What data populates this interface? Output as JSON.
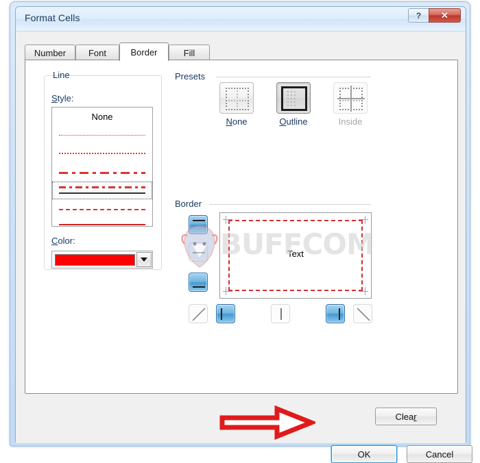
{
  "window": {
    "title": "Format Cells",
    "help_button": "?",
    "close_button": "✕",
    "help_icon": "question-mark-icon",
    "close_icon": "close-x-icon"
  },
  "tabs": [
    {
      "label": "Number",
      "active": false
    },
    {
      "label": "Font",
      "active": false
    },
    {
      "label": "Border",
      "active": true
    },
    {
      "label": "Fill",
      "active": false
    }
  ],
  "line_group": {
    "title": "Line",
    "style_label": "Style:",
    "style_none_option": "None",
    "color_label": "Color:",
    "selected_color": "#FF0000",
    "dropdown_icon": "chevron-down-icon",
    "styles": [
      {
        "id": "none",
        "name": "None",
        "selected": false
      },
      {
        "id": "fine-dotted",
        "name": "Fine dotted",
        "selected": false
      },
      {
        "id": "dotted",
        "name": "Dotted",
        "selected": false
      },
      {
        "id": "dash-dot-lg",
        "name": "Long dash dot",
        "selected": false
      },
      {
        "id": "dash-dot",
        "name": "Dash dot",
        "selected": true
      },
      {
        "id": "dashed",
        "name": "Dashed",
        "selected": false
      },
      {
        "id": "solid",
        "name": "Solid",
        "selected": false
      }
    ]
  },
  "presets": {
    "title": "Presets",
    "items": [
      {
        "label": "None",
        "accel": "N",
        "state": "normal",
        "icon": "border-none-icon"
      },
      {
        "label": "Outline",
        "accel": "O",
        "state": "pressed",
        "icon": "border-outline-icon"
      },
      {
        "label": "Inside",
        "accel": "I",
        "state": "disabled",
        "icon": "border-inside-icon"
      }
    ]
  },
  "border": {
    "title": "Border",
    "preview_text": "Text",
    "preview_border_color": "#D13030",
    "preview_border_style": "dash-dot",
    "edges_applied": [
      "top",
      "bottom",
      "left",
      "right"
    ],
    "side_buttons": [
      {
        "id": "top",
        "icon": "border-top-icon",
        "active": true
      },
      {
        "id": "horizontal-mid",
        "icon": "border-horizontal-mid-icon",
        "active": false
      },
      {
        "id": "bottom",
        "icon": "border-bottom-icon",
        "active": true
      }
    ],
    "bottom_buttons": [
      {
        "id": "diagonal-up",
        "icon": "border-diagonal-up-icon",
        "active": false
      },
      {
        "id": "left",
        "icon": "border-left-icon",
        "active": true
      },
      {
        "id": "vertical-mid",
        "icon": "border-vertical-mid-icon",
        "active": false
      },
      {
        "id": "right",
        "icon": "border-right-icon",
        "active": true
      },
      {
        "id": "diagonal-down",
        "icon": "border-diagonal-down-icon",
        "active": false
      }
    ]
  },
  "buttons": {
    "clear": "Clear",
    "clear_accel": "r",
    "ok": "OK",
    "cancel": "Cancel"
  },
  "annotation": {
    "arrow_color": "#E01B1B",
    "arrow_direction": "right",
    "points_to": "ok-button"
  },
  "watermark": {
    "text": "BUFFCOM",
    "logo": "bull-head-logo"
  }
}
